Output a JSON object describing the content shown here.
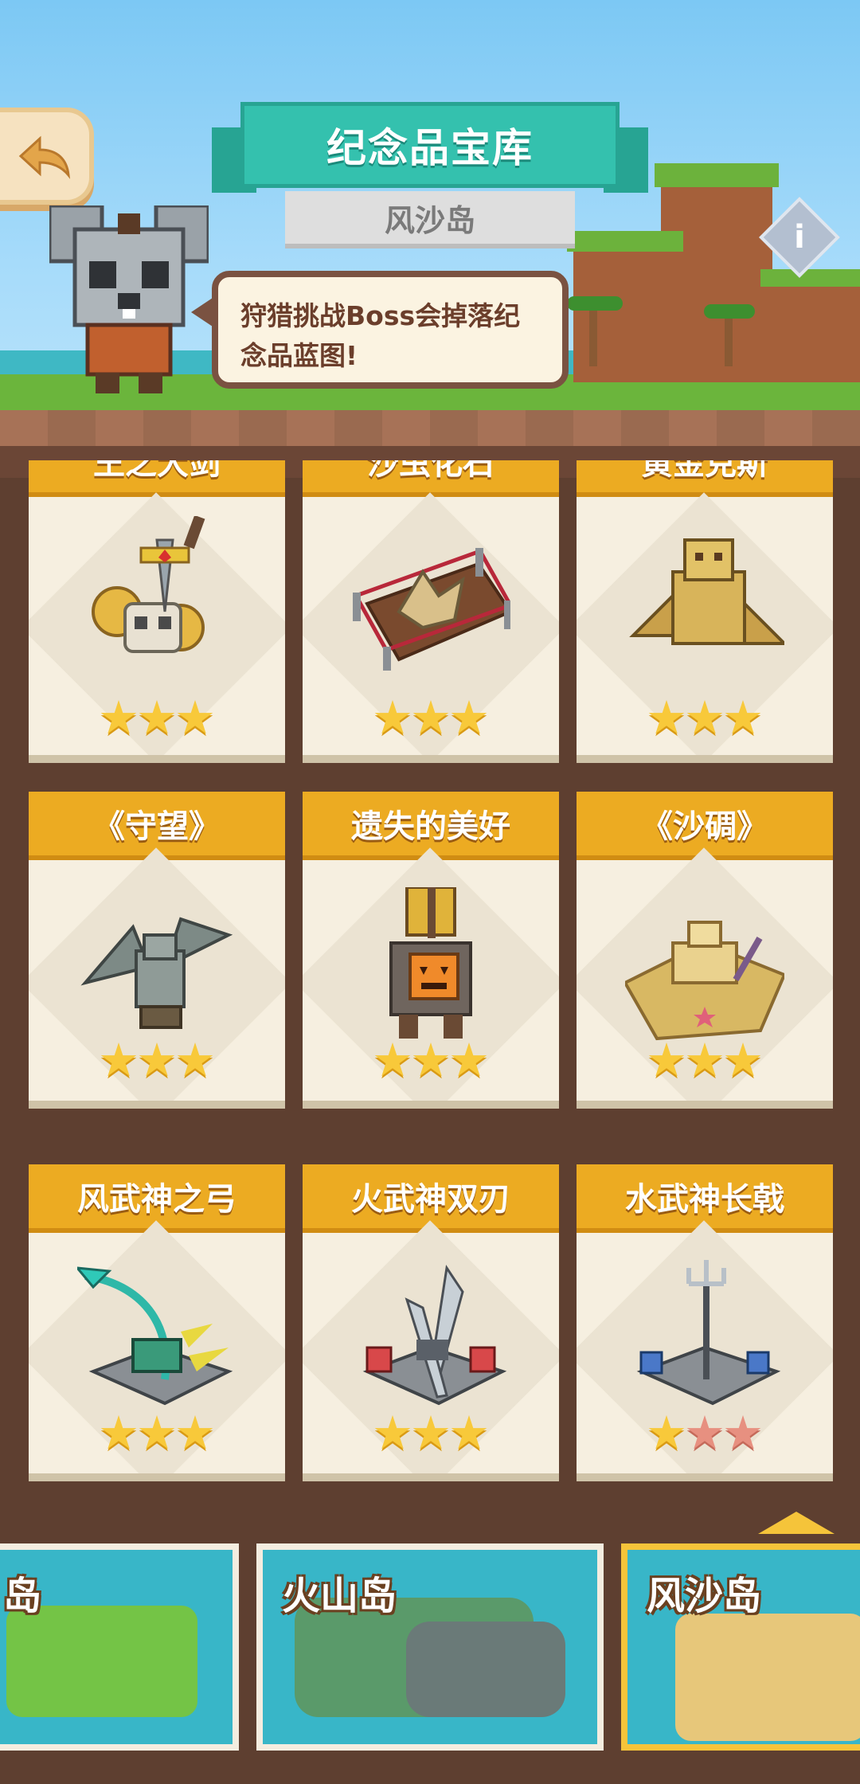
{
  "header": {
    "title": "纪念品宝库",
    "subtitle": "风沙岛",
    "tip": "狩猎挑战Boss会掉落纪念品蓝图!"
  },
  "icons": {
    "back": "back-arrow-icon",
    "info": "info-icon"
  },
  "colors": {
    "teal": "#34c1ae",
    "gold": "#ecab22",
    "brown": "#5e3f30",
    "star": "#f8c93a"
  },
  "souvenirs": [
    {
      "name": "王之大剑",
      "stars": 3,
      "max_stars": 3
    },
    {
      "name": "沙虫化石",
      "stars": 3,
      "max_stars": 3
    },
    {
      "name": "黄金克斯",
      "stars": 3,
      "max_stars": 3
    },
    {
      "name": "《守望》",
      "stars": 3,
      "max_stars": 3
    },
    {
      "name": "遗失的美好",
      "stars": 3,
      "max_stars": 3
    },
    {
      "name": "《沙碉》",
      "stars": 3,
      "max_stars": 3
    },
    {
      "name": "风武神之弓",
      "stars": 3,
      "max_stars": 3
    },
    {
      "name": "火武神双刃",
      "stars": 3,
      "max_stars": 3
    },
    {
      "name": "水武神长戟",
      "stars": 1,
      "max_stars": 3
    }
  ],
  "islands": [
    {
      "name": "岛",
      "selected": false
    },
    {
      "name": "火山岛",
      "selected": false
    },
    {
      "name": "风沙岛",
      "selected": true
    }
  ]
}
